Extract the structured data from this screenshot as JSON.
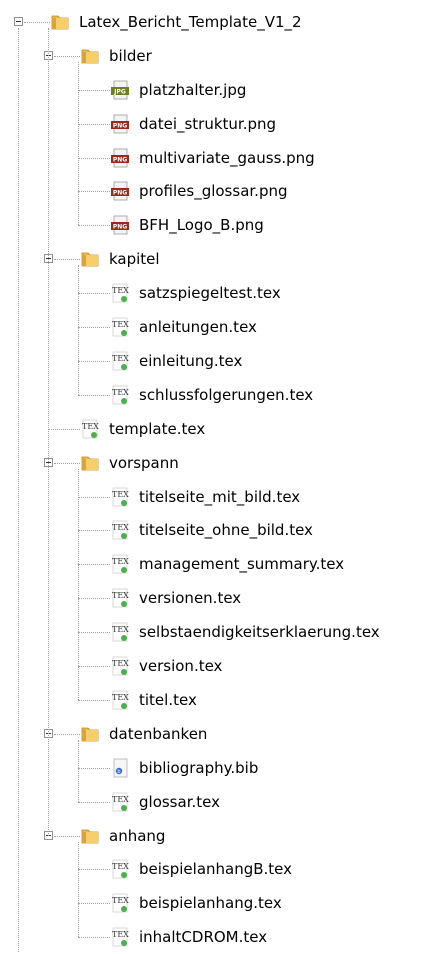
{
  "tree": {
    "root": {
      "label": "Latex_Bericht_Template_V1_2",
      "icon": "folder-icon",
      "expanded": true,
      "children": [
        {
          "label": "bilder",
          "icon": "folder-icon",
          "expanded": true,
          "children": [
            {
              "label": "platzhalter.jpg",
              "icon": "jpg-file-icon"
            },
            {
              "label": "datei_struktur.png",
              "icon": "png-file-icon"
            },
            {
              "label": "multivariate_gauss.png",
              "icon": "png-file-icon"
            },
            {
              "label": "profiles_glossar.png",
              "icon": "png-file-icon"
            },
            {
              "label": "BFH_Logo_B.png",
              "icon": "png-file-icon"
            }
          ]
        },
        {
          "label": "kapitel",
          "icon": "folder-icon",
          "expanded": true,
          "children": [
            {
              "label": "satzspiegeltest.tex",
              "icon": "tex-file-icon"
            },
            {
              "label": "anleitungen.tex",
              "icon": "tex-file-icon"
            },
            {
              "label": "einleitung.tex",
              "icon": "tex-file-icon"
            },
            {
              "label": "schlussfolgerungen.tex",
              "icon": "tex-file-icon"
            }
          ]
        },
        {
          "label": "template.tex",
          "icon": "tex-file-icon"
        },
        {
          "label": "vorspann",
          "icon": "folder-icon",
          "expanded": true,
          "children": [
            {
              "label": "titelseite_mit_bild.tex",
              "icon": "tex-file-icon"
            },
            {
              "label": "titelseite_ohne_bild.tex",
              "icon": "tex-file-icon"
            },
            {
              "label": "management_summary.tex",
              "icon": "tex-file-icon"
            },
            {
              "label": "versionen.tex",
              "icon": "tex-file-icon"
            },
            {
              "label": "selbstaendigkeitserklaerung.tex",
              "icon": "tex-file-icon"
            },
            {
              "label": "version.tex",
              "icon": "tex-file-icon"
            },
            {
              "label": "titel.tex",
              "icon": "tex-file-icon"
            }
          ]
        },
        {
          "label": "datenbanken",
          "icon": "folder-icon",
          "expanded": true,
          "children": [
            {
              "label": "bibliography.bib",
              "icon": "bib-file-icon"
            },
            {
              "label": "glossar.tex",
              "icon": "tex-file-icon"
            }
          ]
        },
        {
          "label": "anhang",
          "icon": "folder-icon",
          "expanded": true,
          "children": [
            {
              "label": "beispielanhangB.tex",
              "icon": "tex-file-icon"
            },
            {
              "label": "beispielanhang.tex",
              "icon": "tex-file-icon"
            },
            {
              "label": "inhaltCDROM.tex",
              "icon": "tex-file-icon"
            }
          ]
        }
      ]
    }
  },
  "colors": {
    "folder": "#e8b84a",
    "jpg_badge": "#6b7f1e",
    "png_badge": "#9a2a1e",
    "tex_badge": "#4caf50",
    "connector": "#a0a0a0"
  }
}
